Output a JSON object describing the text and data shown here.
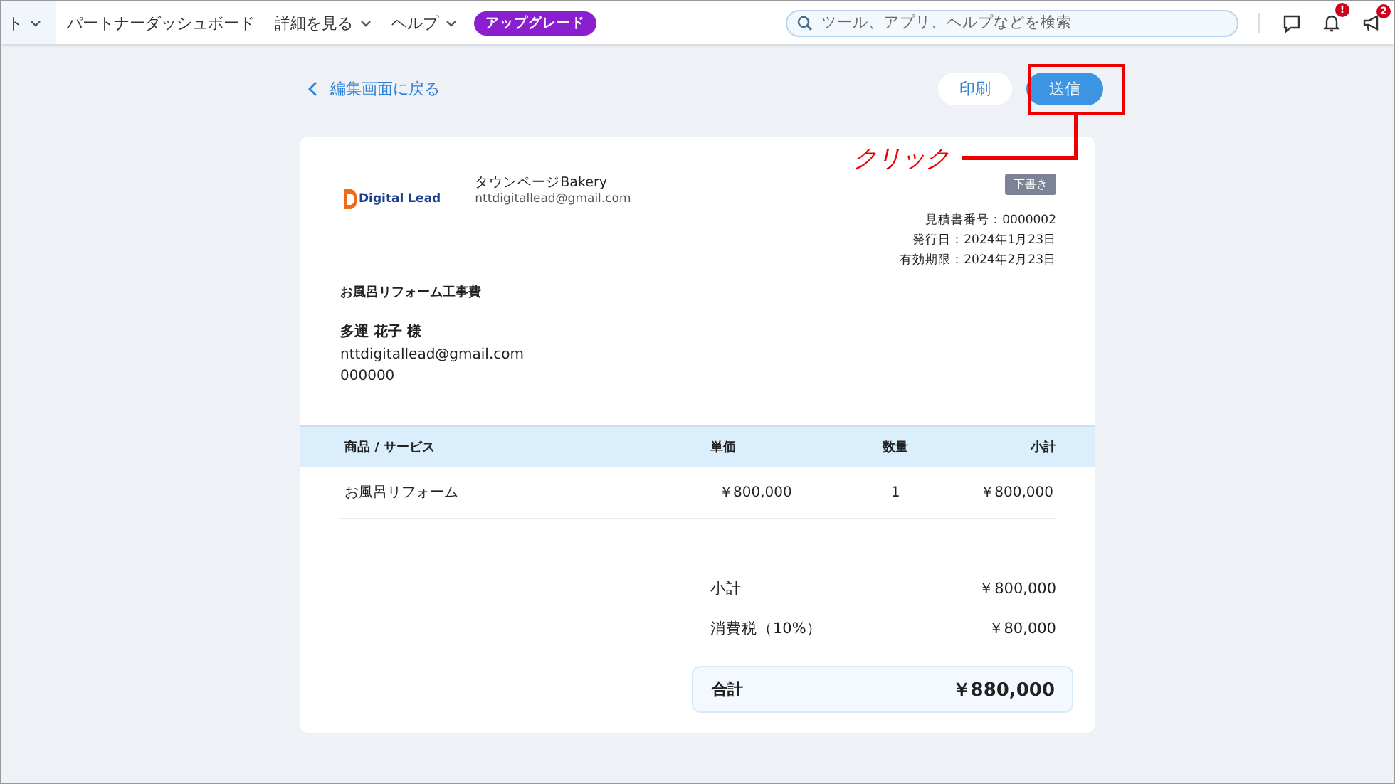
{
  "nav": {
    "items": [
      {
        "label": "ト",
        "dropdown": true,
        "selected": true
      },
      {
        "label": "パートナーダッシュボード",
        "dropdown": false,
        "selected": false
      },
      {
        "label": "詳細を見る",
        "dropdown": true,
        "selected": false
      },
      {
        "label": "ヘルプ",
        "dropdown": true,
        "selected": false
      }
    ],
    "upgrade": "アップグレード",
    "search": {
      "placeholder": "ツール、アプリ、ヘルプなどを検索"
    },
    "notification_badge": "!",
    "announcement_badge": "2"
  },
  "back_link": "編集画面に戻る",
  "actions": [
    {
      "label": "印刷",
      "kind": "secondary"
    },
    {
      "label": "送信",
      "kind": "primary"
    }
  ],
  "annotation": {
    "text": "クリック"
  },
  "quote": {
    "logo": "Digital Lead",
    "company": "タウンページBakery",
    "company_email": "nttdigitallead@gmail.com",
    "status": "下書き",
    "meta": [
      "見積書番号：0000002",
      "発行日：2024年1月23日",
      "有効期限：2024年2月23日"
    ],
    "title": "お風呂リフォーム工事費",
    "customer": {
      "name": "多運 花子 様",
      "email": "nttdigitallead@gmail.com",
      "code": "000000"
    },
    "columns": [
      "商品 / サービス",
      "単価",
      "数量",
      "小計"
    ],
    "rows": [
      [
        "お風呂リフォーム",
        "￥800,000",
        "1",
        "￥800,000"
      ]
    ],
    "totals": [
      {
        "label": "小計",
        "value": "￥800,000"
      },
      {
        "label": "消費税（10%）",
        "value": "￥80,000"
      }
    ],
    "grand_total": {
      "label": "合計",
      "value": "￥880,000"
    }
  }
}
